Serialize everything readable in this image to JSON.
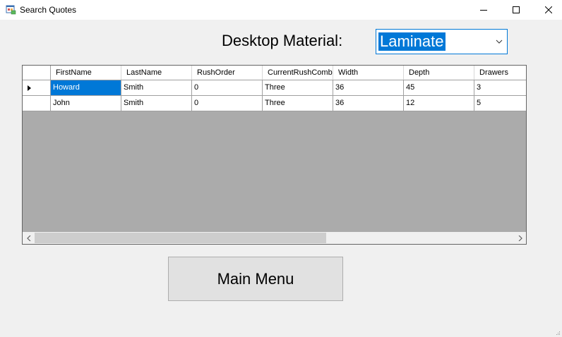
{
  "window": {
    "title": "Search Quotes"
  },
  "form": {
    "material_label": "Desktop Material:",
    "material_selected": "Laminate"
  },
  "grid": {
    "columns": [
      "FirstName",
      "LastName",
      "RushOrder",
      "CurrentRushCombo",
      "Width",
      "Depth",
      "Drawers"
    ],
    "rows": [
      [
        "Howard",
        "Smith",
        "0",
        "Three",
        "36",
        "45",
        "3"
      ],
      [
        "John",
        "Smith",
        "0",
        "Three",
        "36",
        "12",
        "5"
      ]
    ]
  },
  "buttons": {
    "main_menu": "Main Menu"
  },
  "colors": {
    "accent": "#0078d7",
    "grid_background": "#ababab",
    "window_background": "#f0f0f0"
  },
  "icons": {
    "app": "form-window-icon",
    "minimize": "minimize-icon",
    "maximize": "maximize-icon",
    "close": "close-icon",
    "dropdown": "chevron-down-icon",
    "current_row": "row-pointer-icon",
    "scroll_left": "chevron-left-icon",
    "scroll_right": "chevron-right-icon"
  }
}
